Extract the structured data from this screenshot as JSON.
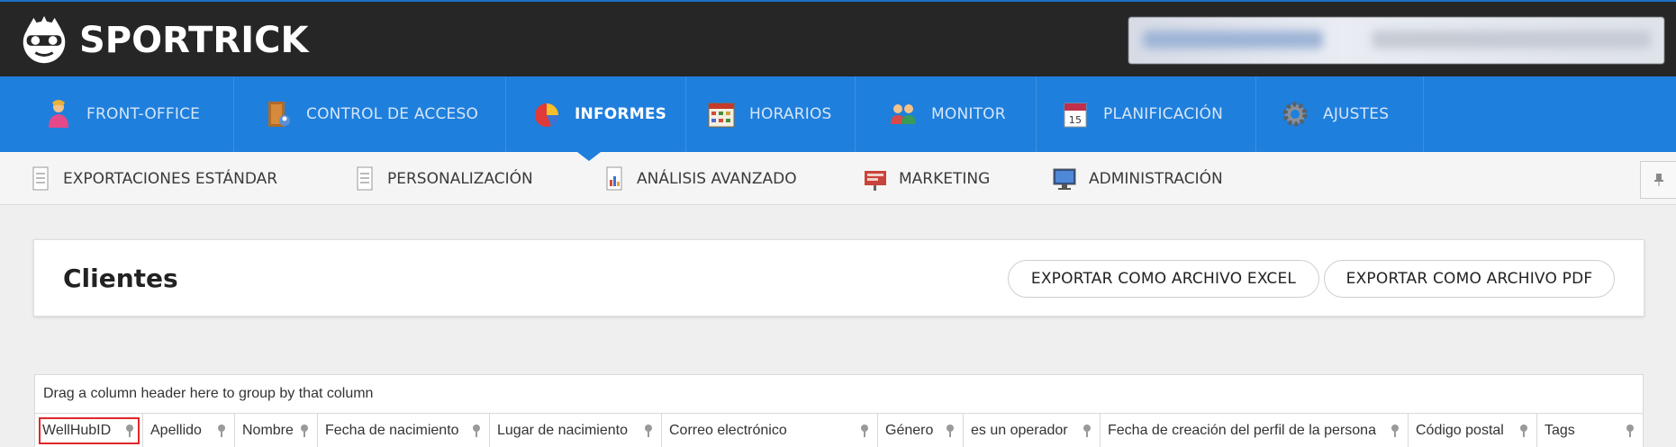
{
  "app": {
    "name": "SPORTRICK"
  },
  "user": {
    "display": ""
  },
  "main_nav": [
    {
      "label": "FRONT-OFFICE",
      "icon": "person-icon"
    },
    {
      "label": "CONTROL DE ACCESO",
      "icon": "door-icon"
    },
    {
      "label": "INFORMES",
      "icon": "pie-chart-icon",
      "active": true
    },
    {
      "label": "HORARIOS",
      "icon": "calendar-grid-icon"
    },
    {
      "label": "MONITOR",
      "icon": "people-icon"
    },
    {
      "label": "PLANIFICACIÓN",
      "icon": "calendar-icon"
    },
    {
      "label": "AJUSTES",
      "icon": "gear-icon"
    }
  ],
  "sub_nav": [
    {
      "label": "EXPORTACIONES ESTÁNDAR",
      "icon": "document-icon"
    },
    {
      "label": "PERSONALIZACIÓN",
      "icon": "document-icon"
    },
    {
      "label": "ANÁLISIS AVANZADO",
      "icon": "report-icon"
    },
    {
      "label": "MARKETING",
      "icon": "marketing-icon"
    },
    {
      "label": "ADMINISTRACIÓN",
      "icon": "monitor-icon"
    }
  ],
  "panel": {
    "title": "Clientes",
    "export_excel": "EXPORTAR COMO ARCHIVO EXCEL",
    "export_pdf": "EXPORTAR COMO ARCHIVO PDF"
  },
  "grid": {
    "group_hint": "Drag a column header here to group by that column",
    "columns": [
      "WellHubID",
      "Apellido",
      "Nombre",
      "Fecha de nacimiento",
      "Lugar de nacimiento",
      "Correo electrónico",
      "Género",
      "es un operador",
      "Fecha de creación del perfil de la persona",
      "Código postal",
      "Tags"
    ]
  },
  "colors": {
    "nav_blue": "#1f7fdc",
    "header_dark": "#262626",
    "highlight": "#e0262b"
  }
}
